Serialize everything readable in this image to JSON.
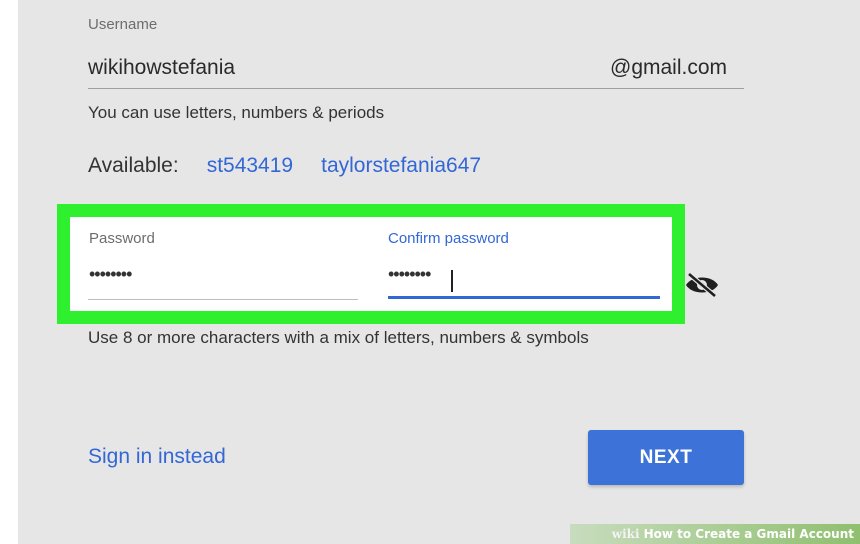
{
  "form": {
    "username_label": "Username",
    "username_value": "wikihowstefania",
    "username_domain": "@gmail.com",
    "username_hint": "You can use letters, numbers & periods",
    "available_label": "Available:",
    "suggestions": [
      "st543419",
      "taylorstefania647"
    ],
    "password_label": "Password",
    "password_value": "••••••••",
    "confirm_label": "Confirm password",
    "confirm_value": "••••••••",
    "password_rules": "Use 8 or more characters with a mix of letters, numbers & symbols",
    "toggle_icon": "eye-off-icon"
  },
  "actions": {
    "sign_in_label": "Sign in instead",
    "next_label": "NEXT"
  },
  "watermark": {
    "brand": "wiki",
    "text": "How to Create a Gmail Account"
  },
  "colors": {
    "accent_blue": "#3367d6",
    "highlight_green": "#2ef02e",
    "background": "#e6e6e6"
  }
}
